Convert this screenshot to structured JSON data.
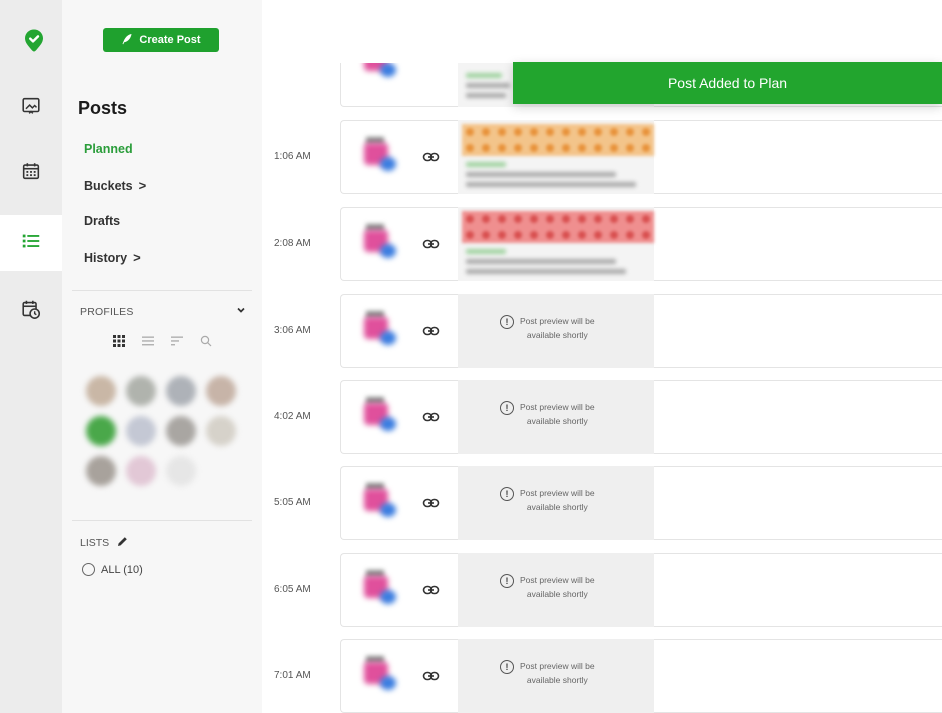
{
  "app": {
    "accent": "#1fa12e",
    "active_text": "#2a9d3a"
  },
  "rail": {
    "items": [
      {
        "name": "media-icon"
      },
      {
        "name": "calendar-icon"
      },
      {
        "name": "list-icon",
        "active": true
      },
      {
        "name": "calendar-clock-icon"
      }
    ]
  },
  "sidebar": {
    "create_label": "Create Post",
    "title": "Posts",
    "nav": [
      {
        "label": "Planned",
        "active": true
      },
      {
        "label": "Buckets",
        "chevron": ">"
      },
      {
        "label": "Drafts"
      },
      {
        "label": "History",
        "chevron": ">"
      }
    ],
    "profiles_label": "PROFILES",
    "lists_label": "LISTS",
    "lists_all": "ALL (10)"
  },
  "toolbar": {
    "search_placeholder": "Search posts"
  },
  "toast": {
    "message": "Post Added to Plan"
  },
  "timeline": {
    "rows": [
      {
        "time": "1:06 AM",
        "preview": "image-orange"
      },
      {
        "time": "2:08 AM",
        "preview": "image-red"
      },
      {
        "time": "3:06 AM",
        "preview": "pending"
      },
      {
        "time": "4:02 AM",
        "preview": "pending"
      },
      {
        "time": "5:05 AM",
        "preview": "pending"
      },
      {
        "time": "6:05 AM",
        "preview": "pending"
      },
      {
        "time": "7:01 AM",
        "preview": "pending"
      }
    ],
    "pending_text_1": "Post preview will be",
    "pending_text_2": "available shortly"
  }
}
